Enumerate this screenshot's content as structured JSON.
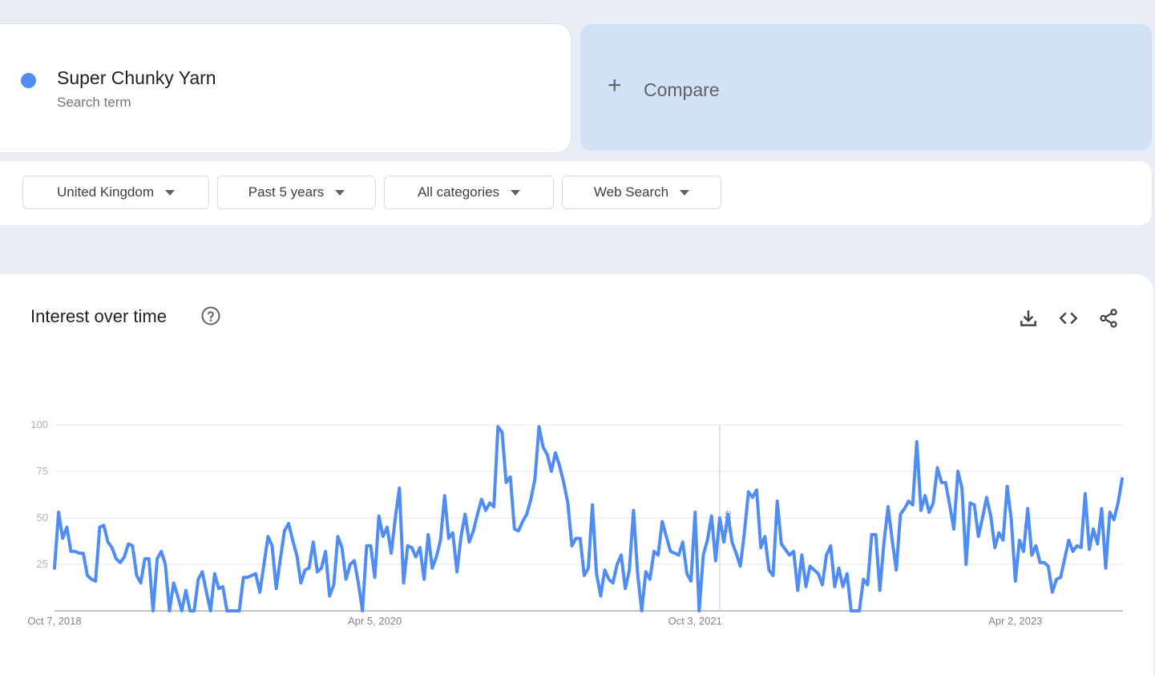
{
  "term": {
    "title": "Super Chunky Yarn",
    "subtitle": "Search term",
    "color": "#4f8df5"
  },
  "compare": {
    "icon": "plus-icon",
    "label": "Compare"
  },
  "filters": [
    {
      "label": "United Kingdom"
    },
    {
      "label": "Past 5 years"
    },
    {
      "label": "All categories"
    },
    {
      "label": "Web Search"
    }
  ],
  "chart_section": {
    "title": "Interest over time",
    "icons": [
      "help-icon",
      "download-icon",
      "embed-icon",
      "share-icon"
    ],
    "note_label": "Note"
  },
  "chart_data": {
    "type": "line",
    "title": "",
    "ylim": [
      0,
      100
    ],
    "y_ticks": [
      25,
      50,
      75,
      100
    ],
    "x_tick_labels": [
      "Oct 7, 2018",
      "Apr 5, 2020",
      "Oct 3, 2021",
      "Apr 2, 2023"
    ],
    "x_tick_indices": [
      0,
      78,
      156,
      234
    ],
    "note_index": 162,
    "grid": true,
    "series": [
      {
        "name": "Super Chunky Yarn",
        "color": "#4f8df5",
        "partial_from_index": 260,
        "values": [
          23,
          53,
          39,
          45,
          32,
          32,
          31,
          31,
          19,
          17,
          16,
          45,
          46,
          37,
          34,
          28,
          26,
          29,
          36,
          35,
          19,
          15,
          28,
          28,
          0,
          28,
          32,
          25,
          0,
          15,
          8,
          0,
          11,
          0,
          0,
          17,
          21,
          10,
          0,
          20,
          12,
          13,
          0,
          0,
          0,
          0,
          18,
          18,
          19,
          20,
          10,
          25,
          40,
          35,
          12,
          28,
          43,
          47,
          38,
          30,
          15,
          22,
          23,
          37,
          21,
          23,
          32,
          8,
          14,
          40,
          34,
          17,
          25,
          27,
          15,
          0,
          35,
          35,
          18,
          51,
          40,
          45,
          31,
          50,
          66,
          15,
          35,
          34,
          29,
          34,
          17,
          41,
          23,
          29,
          38,
          62,
          39,
          42,
          21,
          40,
          52,
          37,
          43,
          52,
          60,
          54,
          58,
          56,
          99,
          96,
          69,
          72,
          44,
          43,
          48,
          52,
          60,
          71,
          99,
          88,
          84,
          75,
          85,
          78,
          69,
          58,
          35,
          39,
          39,
          19,
          23,
          57,
          20,
          8,
          22,
          17,
          15,
          25,
          30,
          12,
          22,
          54,
          20,
          0,
          21,
          17,
          32,
          30,
          48,
          40,
          32,
          31,
          30,
          37,
          20,
          16,
          53,
          0,
          30,
          38,
          51,
          27,
          50,
          37,
          52,
          37,
          31,
          24,
          42,
          64,
          61,
          65,
          34,
          40,
          22,
          19,
          59,
          36,
          33,
          30,
          32,
          11,
          30,
          13,
          24,
          22,
          20,
          14,
          30,
          35,
          13,
          23,
          13,
          20,
          0,
          0,
          0,
          17,
          14,
          41,
          41,
          11,
          37,
          56,
          38,
          22,
          52,
          55,
          59,
          57,
          91,
          54,
          62,
          53,
          58,
          77,
          69,
          69,
          57,
          44,
          75,
          66,
          25,
          58,
          57,
          40,
          50,
          61,
          51,
          34,
          42,
          38,
          67,
          49,
          16,
          38,
          32,
          55,
          30,
          35,
          26,
          26,
          24,
          10,
          17,
          18,
          28,
          38,
          32,
          35,
          34,
          63,
          33,
          44,
          36,
          55,
          23,
          53,
          49,
          58,
          71
        ]
      }
    ]
  }
}
